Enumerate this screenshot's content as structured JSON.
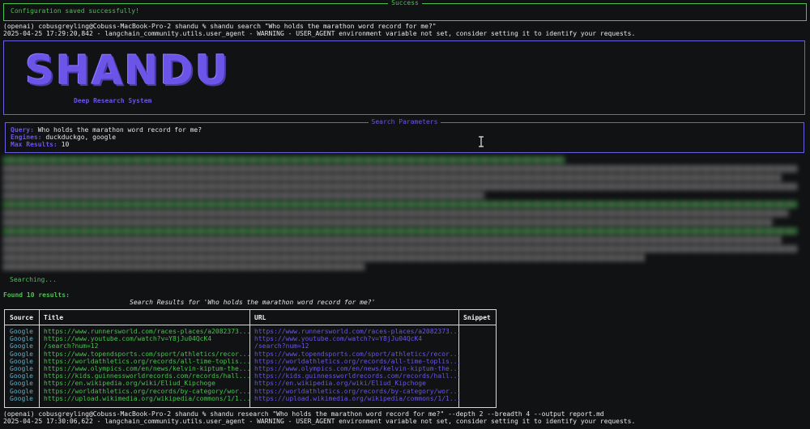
{
  "success": {
    "title": "Success",
    "message": "Configuration saved successfully!"
  },
  "terminal": {
    "cmd1": "(openai) cobusgreyling@Cobuss-MacBook-Pro-2 shandu % shandu search \"Who holds the marathon word record for me?\"",
    "warn1": "2025-04-25 17:29:20,842 - langchain_community.utils.user_agent - WARNING - USER_AGENT environment variable not set, consider setting it to identify your requests.",
    "searching": "Searching...",
    "found": "Found 10 results:",
    "cmd2": "(openai) cobusgreyling@Cobuss-MacBook-Pro-2 shandu % shandu research \"Who holds the marathon word record for me?\" --depth 2 --breadth 4 --output report.md",
    "warn2": "2025-04-25 17:30:06,622 - langchain_community.utils.user_agent - WARNING - USER_AGENT environment variable not set, consider setting it to identify your requests."
  },
  "banner": {
    "logo": "SHANDU",
    "subtitle": "Deep Research System"
  },
  "params": {
    "title": "Search Parameters",
    "query_label": "Query:",
    "query": "Who holds the marathon word record for me?",
    "engines_label": "Engines:",
    "engines": "duckduckgo, google",
    "max_label": "Max Results:",
    "max": "10"
  },
  "results": {
    "title": "Search Results for 'Who holds the marathon word record for me?'",
    "headers": [
      "Source",
      "Title",
      "URL",
      "Snippet"
    ],
    "sources": [
      "Google",
      "Google",
      "Google",
      "Google",
      "Google",
      "Google",
      "Google",
      "Google",
      "Google",
      "Google"
    ],
    "titles": [
      "https://www.runnersworld.com/races-places/a2082373...",
      "https://www.youtube.com/watch?v=Y8jJu04QcK4",
      "/search?num=12",
      "https://www.topendsports.com/sport/athletics/recor...",
      "https://worldathletics.org/records/all-time-toplis...",
      "https://www.olympics.com/en/news/kelvin-kiptum-the...",
      "https://kids.guinnessworldrecords.com/records/hall...",
      "https://en.wikipedia.org/wiki/Eliud_Kipchoge",
      "https://worldathletics.org/records/by-category/wor...",
      "https://upload.wikimedia.org/wikipedia/commons/1/1..."
    ],
    "urls": [
      "https://www.runnersworld.com/races-places/a2082373...",
      "https://www.youtube.com/watch?v=Y8jJu04QcK4",
      "/search?num=12",
      "https://www.topendsports.com/sport/athletics/recor...",
      "https://worldathletics.org/records/all-time-toplis...",
      "https://www.olympics.com/en/news/kelvin-kiptum-the...",
      "https://kids.guinnessworldrecords.com/records/hall...",
      "https://en.wikipedia.org/wiki/Eliud_Kipchoge",
      "https://worldathletics.org/records/by-category/wor...",
      "https://upload.wikimedia.org/wikipedia/commons/1/1..."
    ]
  },
  "colors": {
    "green": "#49c24f",
    "purple": "#6c54e8",
    "cyan": "#5ab0c8"
  }
}
